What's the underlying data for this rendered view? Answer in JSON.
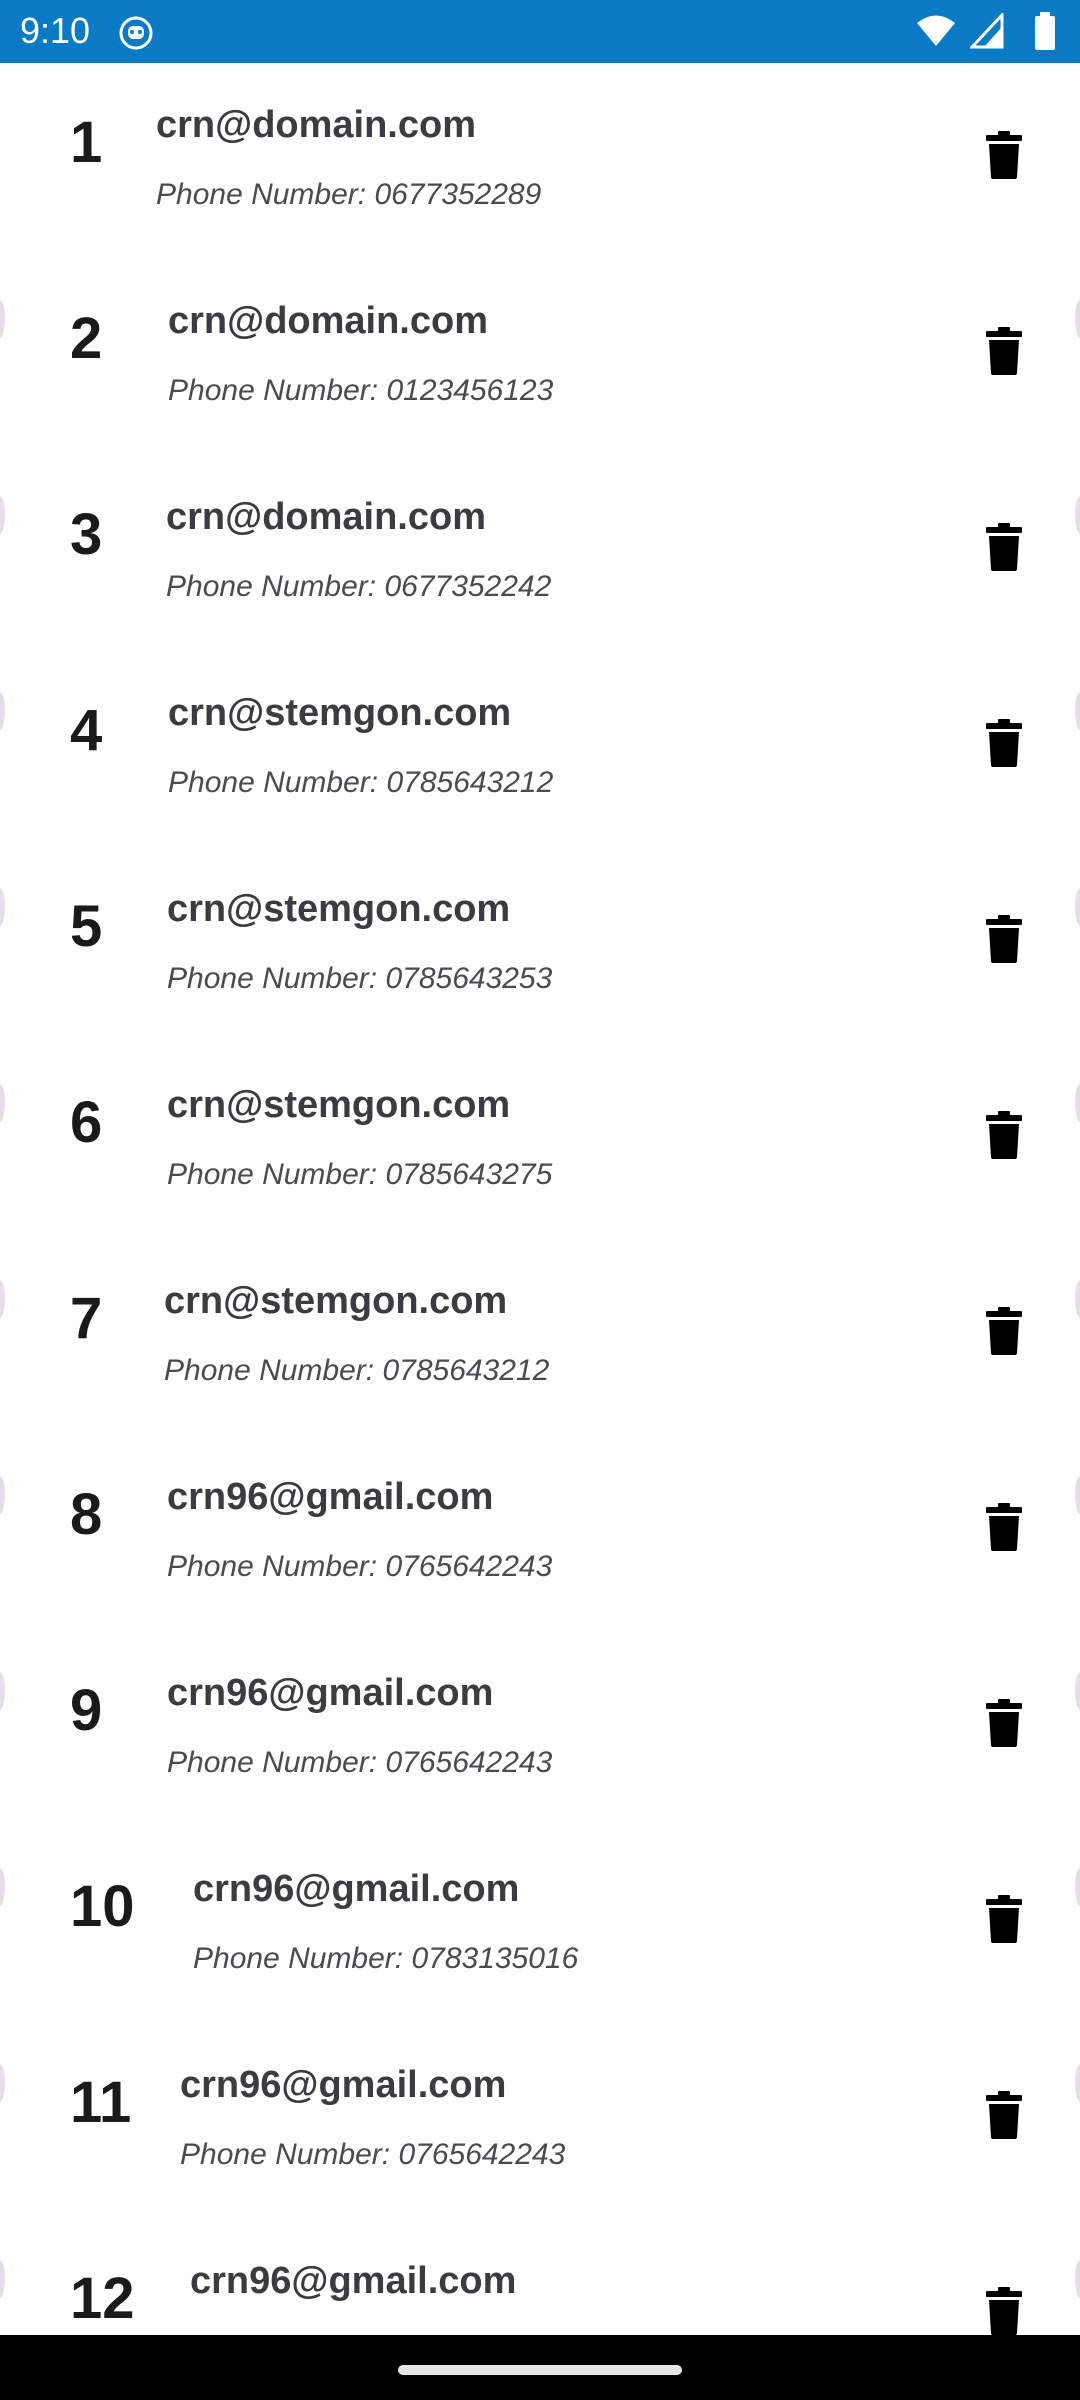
{
  "status_bar": {
    "time": "9:10",
    "background_color": "#0b7ac4",
    "icons": [
      "app-notification-icon",
      "wifi-icon",
      "signal-icon",
      "battery-icon"
    ]
  },
  "contacts": [
    {
      "number": "1",
      "email": "crn@domain.com",
      "phone": "Phone Number: 0677352289"
    },
    {
      "number": "2",
      "email": "crn@domain.com",
      "phone": "Phone Number: 0123456123"
    },
    {
      "number": "3",
      "email": "crn@domain.com",
      "phone": "Phone Number: 0677352242"
    },
    {
      "number": "4",
      "email": "crn@stemgon.com",
      "phone": "Phone Number: 0785643212"
    },
    {
      "number": "5",
      "email": "crn@stemgon.com",
      "phone": "Phone Number: 0785643253"
    },
    {
      "number": "6",
      "email": "crn@stemgon.com",
      "phone": "Phone Number: 0785643275"
    },
    {
      "number": "7",
      "email": "crn@stemgon.com",
      "phone": "Phone Number: 0785643212"
    },
    {
      "number": "8",
      "email": "crn96@gmail.com",
      "phone": "Phone Number: 0765642243"
    },
    {
      "number": "9",
      "email": "crn96@gmail.com",
      "phone": "Phone Number: 0765642243"
    },
    {
      "number": "10",
      "email": "crn96@gmail.com",
      "phone": "Phone Number: 0783135016"
    },
    {
      "number": "11",
      "email": "crn96@gmail.com",
      "phone": "Phone Number: 0765642243"
    },
    {
      "number": "12",
      "email": "crn96@gmail.com",
      "phone": ""
    }
  ],
  "row_icon": "trash-icon",
  "colors": {
    "text_primary": "#3c3b40",
    "number": "#1a1a1a",
    "icon": "#000000"
  }
}
